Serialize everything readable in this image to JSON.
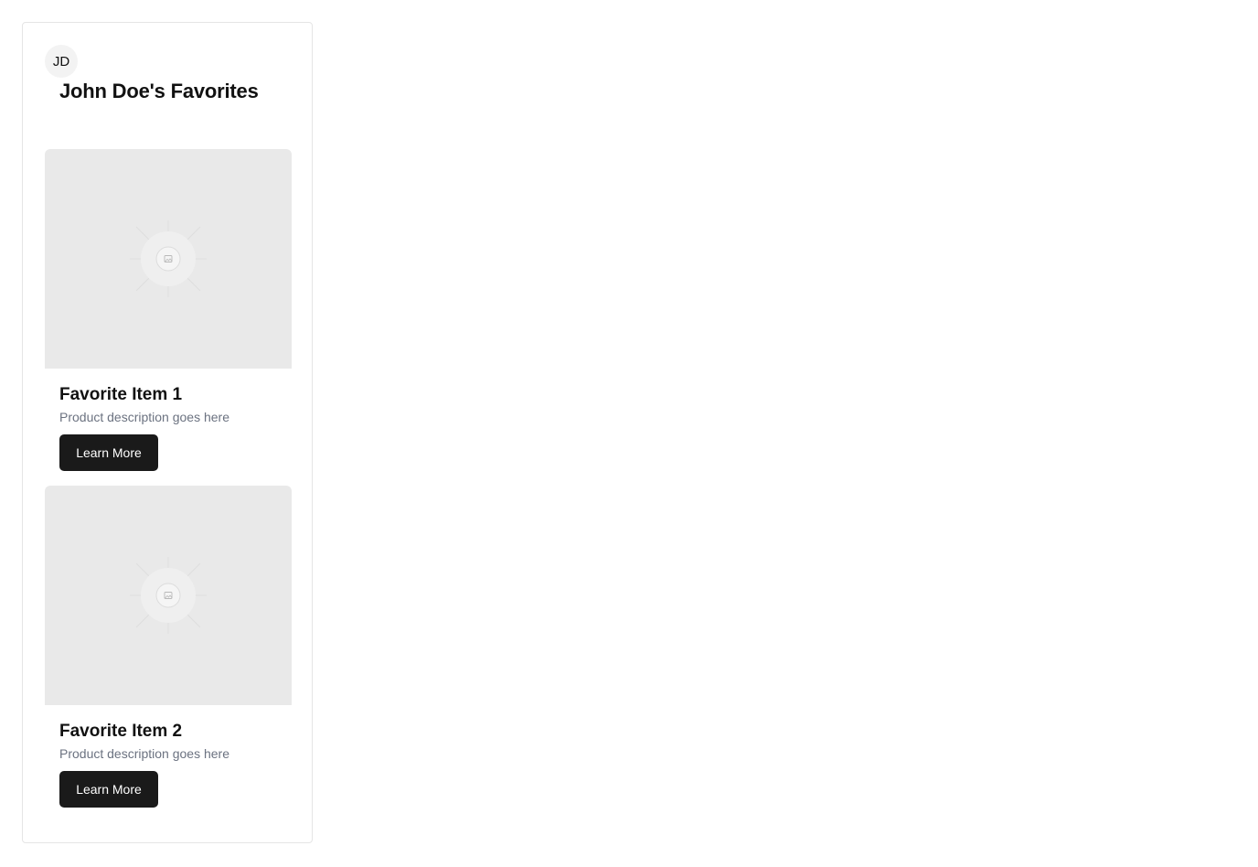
{
  "profile": {
    "initials": "JD",
    "title": "John Doe's Favorites"
  },
  "items": [
    {
      "title": "Favorite Item 1",
      "description": "Product description goes here",
      "button_label": "Learn More",
      "image_icon": "image-placeholder-icon"
    },
    {
      "title": "Favorite Item 2",
      "description": "Product description goes here",
      "button_label": "Learn More",
      "image_icon": "image-placeholder-icon"
    }
  ],
  "colors": {
    "button_bg": "#1a1a1a",
    "button_text": "#ffffff",
    "description_text": "#6b7280",
    "image_placeholder": "#e9e9e9",
    "card_border": "#e5e5e5"
  }
}
